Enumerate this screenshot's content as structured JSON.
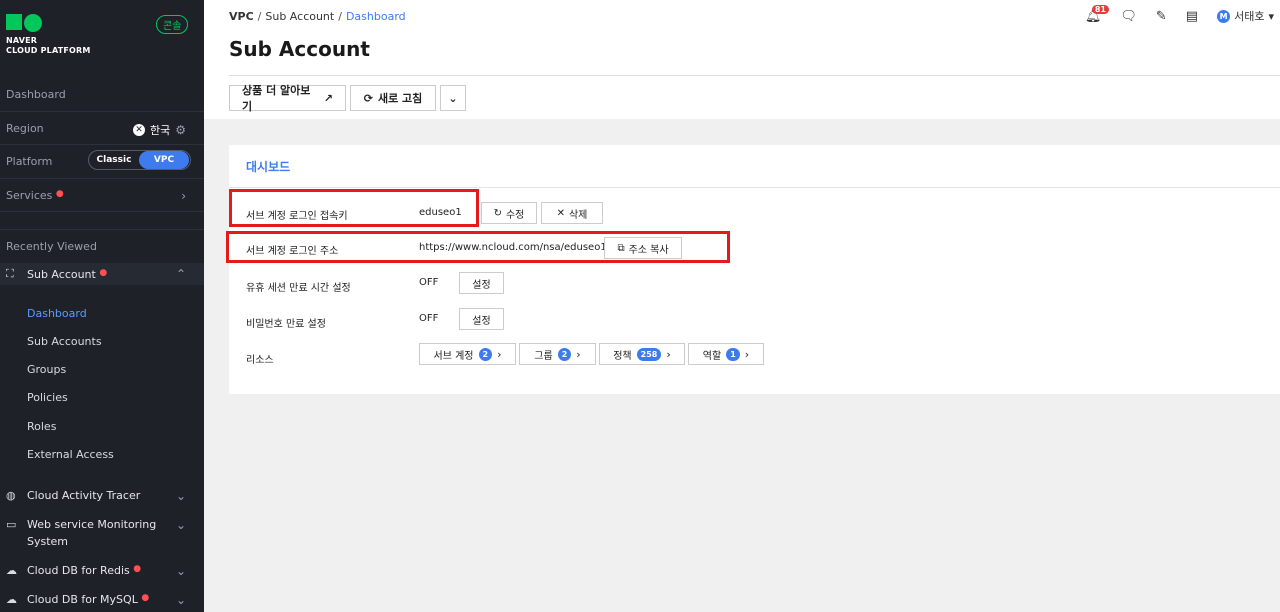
{
  "sidebar": {
    "logo_line1": "NAVER",
    "logo_line2": "CLOUD PLATFORM",
    "console_badge": "콘솔",
    "dashboard": "Dashboard",
    "region_label": "Region",
    "region_value": "한국",
    "platform_label": "Platform",
    "platform_options": [
      "Classic",
      "VPC"
    ],
    "platform_selected": "VPC",
    "services_label": "Services",
    "recently_viewed": "Recently Viewed",
    "sub_account": "Sub Account",
    "sub_items": [
      "Dashboard",
      "Sub Accounts",
      "Groups",
      "Policies",
      "Roles",
      "External Access"
    ],
    "menu": [
      {
        "label": "Cloud Activity Tracer"
      },
      {
        "label": "Web service Monitoring",
        "label2": "System"
      },
      {
        "label": "Cloud DB for Redis"
      },
      {
        "label": "Cloud DB for MySQL"
      }
    ]
  },
  "header": {
    "breadcrumb": [
      "VPC",
      "Sub Account",
      "Dashboard"
    ],
    "title": "Sub Account",
    "notification_count": "81",
    "user_initial": "M",
    "user_name": "서태호"
  },
  "toolbar": {
    "learn_more": "상품 더 알아보기",
    "refresh": "새로 고침"
  },
  "card": {
    "title": "대시보드",
    "rows": {
      "login_key_label": "서브 계정 로그인 접속키",
      "login_key_value": "eduseo1",
      "edit_btn": "수정",
      "delete_btn": "삭제",
      "login_url_label": "서브 계정 로그인 주소",
      "login_url_value": "https://www.ncloud.com/nsa/eduseo1",
      "copy_btn": "주소 복사",
      "idle_label": "유휴 세션 만료 시간 설정",
      "idle_value": "OFF",
      "idle_btn": "설정",
      "pw_label": "비밀번호 만료 설정",
      "pw_value": "OFF",
      "pw_btn": "설정",
      "resource_label": "리소스"
    },
    "resources": [
      {
        "label": "서브 계정",
        "count": "2"
      },
      {
        "label": "그룹",
        "count": "2"
      },
      {
        "label": "정책",
        "count": "258"
      },
      {
        "label": "역할",
        "count": "1"
      }
    ]
  },
  "colors": {
    "sidebar_bg": "#1e2128",
    "accent": "#3d7bef",
    "brand_green": "#03c75a",
    "highlight_red": "#e31b1b"
  }
}
